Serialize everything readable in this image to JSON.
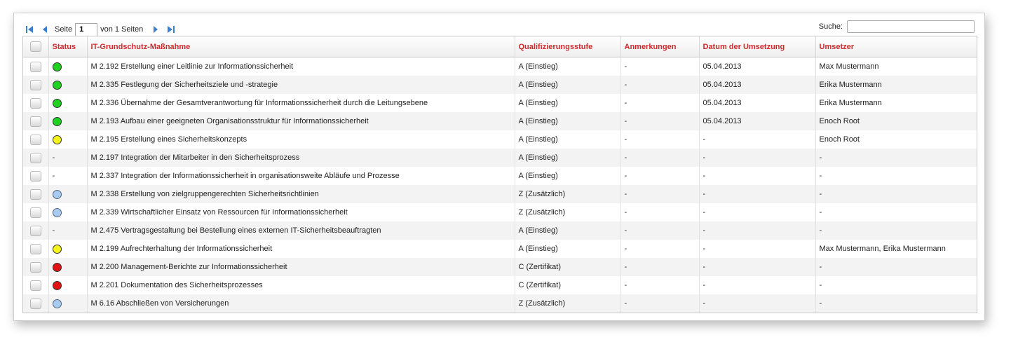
{
  "pager": {
    "page_label": "Seite",
    "page_value": "1",
    "of_label": "von 1 Seiten"
  },
  "search": {
    "label": "Suche:",
    "value": ""
  },
  "columns": {
    "status": "Status",
    "massnahme": "IT-Grundschutz-Maßnahme",
    "stufe": "Qualifizierungsstufe",
    "anmerkungen": "Anmerkungen",
    "datum": "Datum der Umsetzung",
    "umsetzer": "Umsetzer"
  },
  "status_colors": {
    "green": "#1fd21f",
    "yellow": "#f6f31b",
    "red": "#e01414",
    "blue": "#a7caf0"
  },
  "rows": [
    {
      "status": "green",
      "status_text": "",
      "massnahme": "M 2.192 Erstellung einer Leitlinie zur Informationssicherheit",
      "stufe": "A (Einstieg)",
      "anmerkungen": "-",
      "datum": "05.04.2013",
      "umsetzer": "Max Mustermann"
    },
    {
      "status": "green",
      "status_text": "",
      "massnahme": "M 2.335 Festlegung der Sicherheitsziele und -strategie",
      "stufe": "A (Einstieg)",
      "anmerkungen": "-",
      "datum": "05.04.2013",
      "umsetzer": "Erika Mustermann"
    },
    {
      "status": "green",
      "status_text": "",
      "massnahme": "M 2.336 Übernahme der Gesamtverantwortung für Informationssicherheit durch die Leitungsebene",
      "stufe": "A (Einstieg)",
      "anmerkungen": "-",
      "datum": "05.04.2013",
      "umsetzer": "Erika Mustermann"
    },
    {
      "status": "green",
      "status_text": "",
      "massnahme": "M 2.193 Aufbau einer geeigneten Organisationsstruktur für Informationssicherheit",
      "stufe": "A (Einstieg)",
      "anmerkungen": "-",
      "datum": "05.04.2013",
      "umsetzer": "Enoch Root"
    },
    {
      "status": "yellow",
      "status_text": "",
      "massnahme": "M 2.195 Erstellung eines Sicherheitskonzepts",
      "stufe": "A (Einstieg)",
      "anmerkungen": "-",
      "datum": "-",
      "umsetzer": "Enoch Root"
    },
    {
      "status": "none",
      "status_text": "-",
      "massnahme": "M 2.197 Integration der Mitarbeiter in den Sicherheitsprozess",
      "stufe": "A (Einstieg)",
      "anmerkungen": "-",
      "datum": "-",
      "umsetzer": "-"
    },
    {
      "status": "none",
      "status_text": "-",
      "massnahme": "M 2.337 Integration der Informationssicherheit in organisationsweite Abläufe und Prozesse",
      "stufe": "A (Einstieg)",
      "anmerkungen": "-",
      "datum": "-",
      "umsetzer": "-"
    },
    {
      "status": "blue",
      "status_text": "",
      "massnahme": "M 2.338 Erstellung von zielgruppengerechten Sicherheitsrichtlinien",
      "stufe": "Z (Zusätzlich)",
      "anmerkungen": "-",
      "datum": "-",
      "umsetzer": "-"
    },
    {
      "status": "blue",
      "status_text": "",
      "massnahme": "M 2.339 Wirtschaftlicher Einsatz von Ressourcen für Informationssicherheit",
      "stufe": "Z (Zusätzlich)",
      "anmerkungen": "-",
      "datum": "-",
      "umsetzer": "-"
    },
    {
      "status": "none",
      "status_text": "-",
      "massnahme": "M 2.475 Vertragsgestaltung bei Bestellung eines externen IT-Sicherheitsbeauftragten",
      "stufe": "A (Einstieg)",
      "anmerkungen": "-",
      "datum": "-",
      "umsetzer": "-"
    },
    {
      "status": "yellow",
      "status_text": "",
      "massnahme": "M 2.199 Aufrechterhaltung der Informationssicherheit",
      "stufe": "A (Einstieg)",
      "anmerkungen": "-",
      "datum": "-",
      "umsetzer": "Max Mustermann, Erika Mustermann"
    },
    {
      "status": "red",
      "status_text": "",
      "massnahme": "M 2.200 Management-Berichte zur Informationssicherheit",
      "stufe": "C (Zertifikat)",
      "anmerkungen": "-",
      "datum": "-",
      "umsetzer": "-"
    },
    {
      "status": "red",
      "status_text": "",
      "massnahme": "M 2.201 Dokumentation des Sicherheitsprozesses",
      "stufe": "C (Zertifikat)",
      "anmerkungen": "-",
      "datum": "-",
      "umsetzer": "-"
    },
    {
      "status": "blue",
      "status_text": "",
      "massnahme": "M 6.16 Abschließen von Versicherungen",
      "stufe": "Z (Zusätzlich)",
      "anmerkungen": "-",
      "datum": "-",
      "umsetzer": "-"
    }
  ]
}
